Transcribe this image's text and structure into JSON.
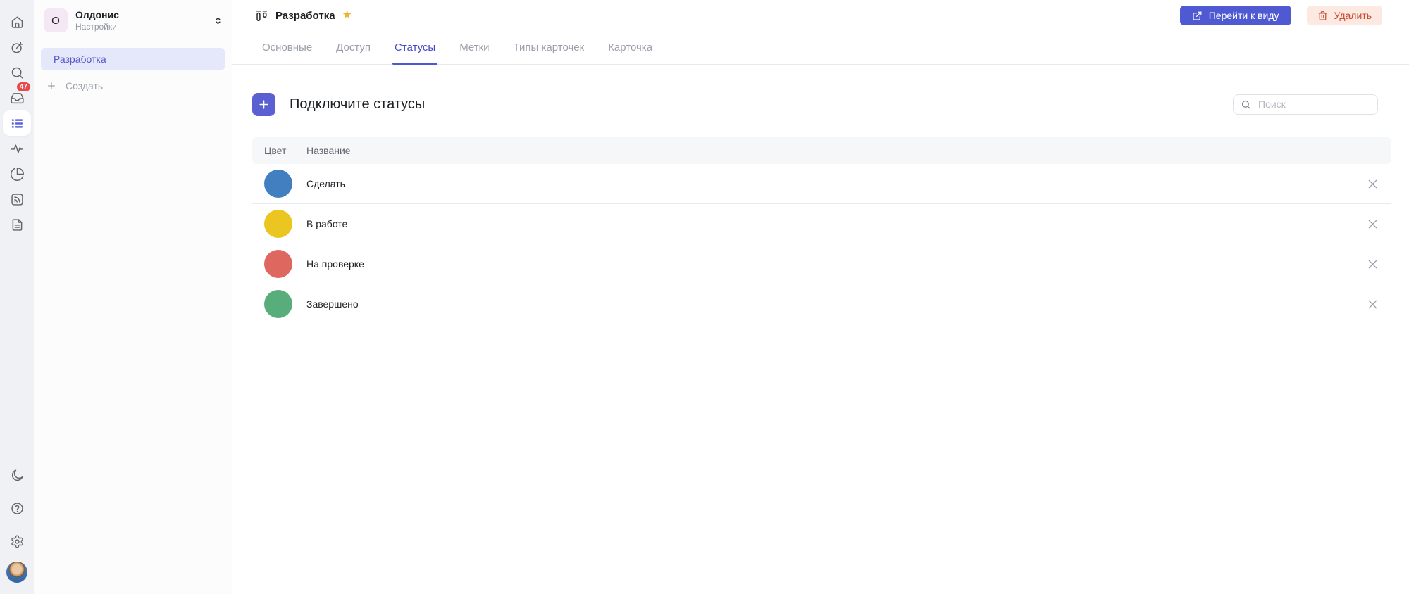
{
  "colors": {
    "accent": "#4E59D2",
    "danger_bg": "#FBE9E2",
    "danger_text": "#C8492C",
    "badge": "#E5484D",
    "star": "#EDB431",
    "tab_active": "#4348CB",
    "selected_item_bg": "#E5E7FB"
  },
  "rail": {
    "badge_count": "47",
    "icons": [
      "home-icon",
      "goals-icon",
      "search-icon",
      "inbox-icon",
      "lists-icon",
      "activity-icon",
      "pie-chart-icon",
      "feed-icon",
      "document-icon"
    ],
    "bottom_icons": [
      "moon-icon",
      "help-icon",
      "gear-icon",
      "user-avatar-photo"
    ]
  },
  "workspace": {
    "initial": "О",
    "name": "Олдонис",
    "subtitle": "Настройки"
  },
  "sidebar": {
    "items": [
      {
        "label": "Разработка",
        "active": true
      }
    ],
    "create_label": "Создать"
  },
  "header": {
    "title": "Разработка",
    "star": "★",
    "goto_button": "Перейти к виду",
    "delete_button": "Удалить"
  },
  "tabs": [
    {
      "id": "osnovnye",
      "label": "Основные",
      "active": false
    },
    {
      "id": "dostup",
      "label": "Доступ",
      "active": false
    },
    {
      "id": "statusy",
      "label": "Статусы",
      "active": true
    },
    {
      "id": "metki",
      "label": "Метки",
      "active": false
    },
    {
      "id": "tipy-kartochek",
      "label": "Типы карточек",
      "active": false
    },
    {
      "id": "kartochka",
      "label": "Карточка",
      "active": false
    }
  ],
  "content": {
    "heading": "Подключите статусы",
    "search_placeholder": "Поиск"
  },
  "table": {
    "columns": [
      "Цвет",
      "Название"
    ],
    "rows": [
      {
        "color": "#417FC1",
        "name": "Сделать"
      },
      {
        "color": "#EBC520",
        "name": "В работе"
      },
      {
        "color": "#DE675F",
        "name": "На проверке"
      },
      {
        "color": "#57AE7B",
        "name": "Завершено"
      }
    ]
  }
}
